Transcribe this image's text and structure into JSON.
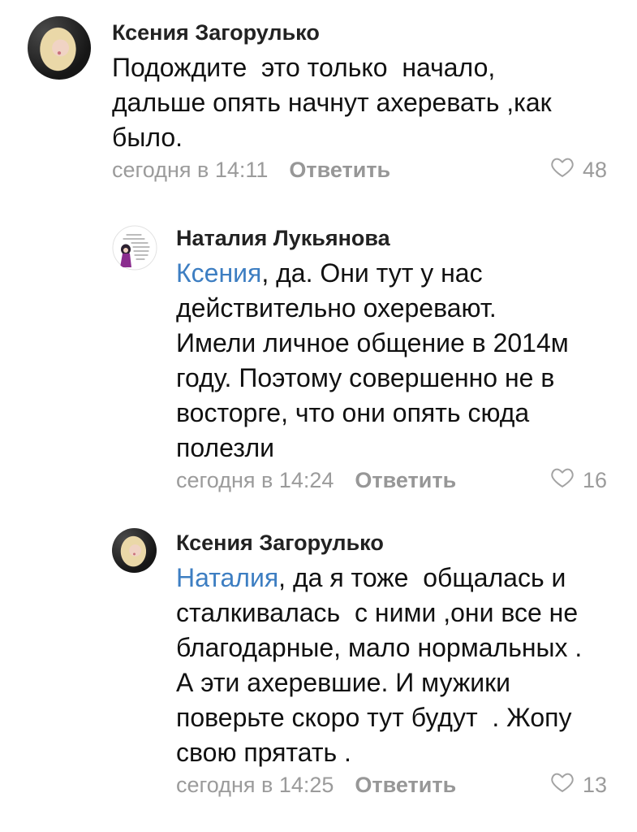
{
  "colors": {
    "text": "#111111",
    "author": "#222222",
    "link": "#3d7ec2",
    "meta": "#9b9b9b",
    "icon": "#a3a3a3"
  },
  "icons": {
    "like": "heart-outline-icon"
  },
  "comments": [
    {
      "author": "Ксения Загорулько",
      "lines": [
        "Подождите  это только  начало,",
        "дальше опять начнут ахеревать ,как",
        "было."
      ],
      "time": "сегодня в 14:11",
      "reply_label": "Ответить",
      "likes": "48"
    },
    {
      "author": "Наталия Лукьянова",
      "mention": "Ксения",
      "lines": [
        ", да. Они тут у нас",
        "действительно охеревают.",
        "Имели личное общение в 2014м",
        "году. Поэтому совершенно не в",
        "восторге, что они опять сюда",
        "полезли"
      ],
      "time": "сегодня в 14:24",
      "reply_label": "Ответить",
      "likes": "16"
    },
    {
      "author": "Ксения Загорулько",
      "mention": "Наталия",
      "lines": [
        ", да я тоже  общалась и",
        "сталкивалась  с ними ,они все не",
        "благодарные, мало нормальных .",
        "А эти ахеревшие. И мужики",
        "поверьте скоро тут будут  . Жопу",
        "свою прятать ."
      ],
      "time": "сегодня в 14:25",
      "reply_label": "Ответить",
      "likes": "13"
    }
  ]
}
